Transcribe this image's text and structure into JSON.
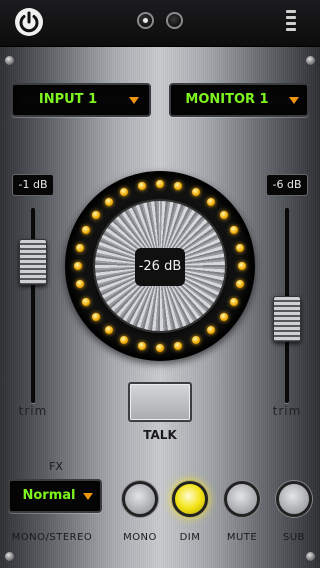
{
  "header": {
    "icons": {
      "power": "power-icon",
      "menu": "menu-icon"
    },
    "page_indicator": {
      "count": 2,
      "active": 0
    }
  },
  "input_select": {
    "value": "INPUT 1"
  },
  "monitor_select": {
    "value": "MONITOR 1"
  },
  "left_trim": {
    "readout": "-1 dB",
    "label": "trim"
  },
  "right_trim": {
    "readout": "-6 dB",
    "label": "trim"
  },
  "volume_knob": {
    "value": "-26 dB"
  },
  "talk": {
    "label": "TALK"
  },
  "fx": {
    "label": "FX",
    "value": "Normal"
  },
  "buttons": {
    "mono_stereo": "MONO/STEREO",
    "mono": "MONO",
    "dim": "DIM",
    "mute": "MUTE",
    "sub": "SUB"
  },
  "colors": {
    "lcd_text": "#7ef51f",
    "led": "#f3b10b",
    "dim_lit": "#f3e417",
    "arrow": "#f0960e"
  }
}
